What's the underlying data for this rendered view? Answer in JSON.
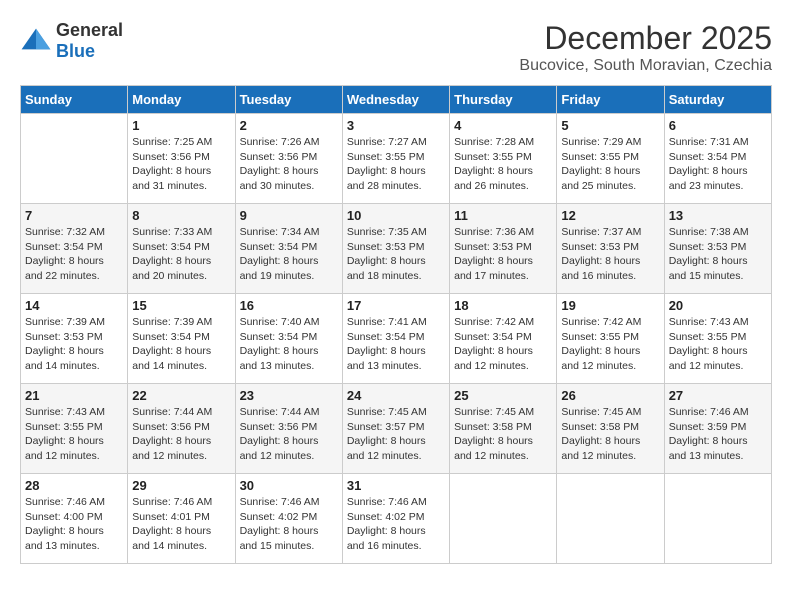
{
  "header": {
    "logo": {
      "general": "General",
      "blue": "Blue"
    },
    "month_year": "December 2025",
    "location": "Bucovice, South Moravian, Czechia"
  },
  "weekdays": [
    "Sunday",
    "Monday",
    "Tuesday",
    "Wednesday",
    "Thursday",
    "Friday",
    "Saturday"
  ],
  "weeks": [
    [
      {
        "day": "",
        "sunrise": "",
        "sunset": "",
        "daylight": ""
      },
      {
        "day": "1",
        "sunrise": "Sunrise: 7:25 AM",
        "sunset": "Sunset: 3:56 PM",
        "daylight": "Daylight: 8 hours and 31 minutes."
      },
      {
        "day": "2",
        "sunrise": "Sunrise: 7:26 AM",
        "sunset": "Sunset: 3:56 PM",
        "daylight": "Daylight: 8 hours and 30 minutes."
      },
      {
        "day": "3",
        "sunrise": "Sunrise: 7:27 AM",
        "sunset": "Sunset: 3:55 PM",
        "daylight": "Daylight: 8 hours and 28 minutes."
      },
      {
        "day": "4",
        "sunrise": "Sunrise: 7:28 AM",
        "sunset": "Sunset: 3:55 PM",
        "daylight": "Daylight: 8 hours and 26 minutes."
      },
      {
        "day": "5",
        "sunrise": "Sunrise: 7:29 AM",
        "sunset": "Sunset: 3:55 PM",
        "daylight": "Daylight: 8 hours and 25 minutes."
      },
      {
        "day": "6",
        "sunrise": "Sunrise: 7:31 AM",
        "sunset": "Sunset: 3:54 PM",
        "daylight": "Daylight: 8 hours and 23 minutes."
      }
    ],
    [
      {
        "day": "7",
        "sunrise": "Sunrise: 7:32 AM",
        "sunset": "Sunset: 3:54 PM",
        "daylight": "Daylight: 8 hours and 22 minutes."
      },
      {
        "day": "8",
        "sunrise": "Sunrise: 7:33 AM",
        "sunset": "Sunset: 3:54 PM",
        "daylight": "Daylight: 8 hours and 20 minutes."
      },
      {
        "day": "9",
        "sunrise": "Sunrise: 7:34 AM",
        "sunset": "Sunset: 3:54 PM",
        "daylight": "Daylight: 8 hours and 19 minutes."
      },
      {
        "day": "10",
        "sunrise": "Sunrise: 7:35 AM",
        "sunset": "Sunset: 3:53 PM",
        "daylight": "Daylight: 8 hours and 18 minutes."
      },
      {
        "day": "11",
        "sunrise": "Sunrise: 7:36 AM",
        "sunset": "Sunset: 3:53 PM",
        "daylight": "Daylight: 8 hours and 17 minutes."
      },
      {
        "day": "12",
        "sunrise": "Sunrise: 7:37 AM",
        "sunset": "Sunset: 3:53 PM",
        "daylight": "Daylight: 8 hours and 16 minutes."
      },
      {
        "day": "13",
        "sunrise": "Sunrise: 7:38 AM",
        "sunset": "Sunset: 3:53 PM",
        "daylight": "Daylight: 8 hours and 15 minutes."
      }
    ],
    [
      {
        "day": "14",
        "sunrise": "Sunrise: 7:39 AM",
        "sunset": "Sunset: 3:53 PM",
        "daylight": "Daylight: 8 hours and 14 minutes."
      },
      {
        "day": "15",
        "sunrise": "Sunrise: 7:39 AM",
        "sunset": "Sunset: 3:54 PM",
        "daylight": "Daylight: 8 hours and 14 minutes."
      },
      {
        "day": "16",
        "sunrise": "Sunrise: 7:40 AM",
        "sunset": "Sunset: 3:54 PM",
        "daylight": "Daylight: 8 hours and 13 minutes."
      },
      {
        "day": "17",
        "sunrise": "Sunrise: 7:41 AM",
        "sunset": "Sunset: 3:54 PM",
        "daylight": "Daylight: 8 hours and 13 minutes."
      },
      {
        "day": "18",
        "sunrise": "Sunrise: 7:42 AM",
        "sunset": "Sunset: 3:54 PM",
        "daylight": "Daylight: 8 hours and 12 minutes."
      },
      {
        "day": "19",
        "sunrise": "Sunrise: 7:42 AM",
        "sunset": "Sunset: 3:55 PM",
        "daylight": "Daylight: 8 hours and 12 minutes."
      },
      {
        "day": "20",
        "sunrise": "Sunrise: 7:43 AM",
        "sunset": "Sunset: 3:55 PM",
        "daylight": "Daylight: 8 hours and 12 minutes."
      }
    ],
    [
      {
        "day": "21",
        "sunrise": "Sunrise: 7:43 AM",
        "sunset": "Sunset: 3:55 PM",
        "daylight": "Daylight: 8 hours and 12 minutes."
      },
      {
        "day": "22",
        "sunrise": "Sunrise: 7:44 AM",
        "sunset": "Sunset: 3:56 PM",
        "daylight": "Daylight: 8 hours and 12 minutes."
      },
      {
        "day": "23",
        "sunrise": "Sunrise: 7:44 AM",
        "sunset": "Sunset: 3:56 PM",
        "daylight": "Daylight: 8 hours and 12 minutes."
      },
      {
        "day": "24",
        "sunrise": "Sunrise: 7:45 AM",
        "sunset": "Sunset: 3:57 PM",
        "daylight": "Daylight: 8 hours and 12 minutes."
      },
      {
        "day": "25",
        "sunrise": "Sunrise: 7:45 AM",
        "sunset": "Sunset: 3:58 PM",
        "daylight": "Daylight: 8 hours and 12 minutes."
      },
      {
        "day": "26",
        "sunrise": "Sunrise: 7:45 AM",
        "sunset": "Sunset: 3:58 PM",
        "daylight": "Daylight: 8 hours and 12 minutes."
      },
      {
        "day": "27",
        "sunrise": "Sunrise: 7:46 AM",
        "sunset": "Sunset: 3:59 PM",
        "daylight": "Daylight: 8 hours and 13 minutes."
      }
    ],
    [
      {
        "day": "28",
        "sunrise": "Sunrise: 7:46 AM",
        "sunset": "Sunset: 4:00 PM",
        "daylight": "Daylight: 8 hours and 13 minutes."
      },
      {
        "day": "29",
        "sunrise": "Sunrise: 7:46 AM",
        "sunset": "Sunset: 4:01 PM",
        "daylight": "Daylight: 8 hours and 14 minutes."
      },
      {
        "day": "30",
        "sunrise": "Sunrise: 7:46 AM",
        "sunset": "Sunset: 4:02 PM",
        "daylight": "Daylight: 8 hours and 15 minutes."
      },
      {
        "day": "31",
        "sunrise": "Sunrise: 7:46 AM",
        "sunset": "Sunset: 4:02 PM",
        "daylight": "Daylight: 8 hours and 16 minutes."
      },
      {
        "day": "",
        "sunrise": "",
        "sunset": "",
        "daylight": ""
      },
      {
        "day": "",
        "sunrise": "",
        "sunset": "",
        "daylight": ""
      },
      {
        "day": "",
        "sunrise": "",
        "sunset": "",
        "daylight": ""
      }
    ]
  ]
}
